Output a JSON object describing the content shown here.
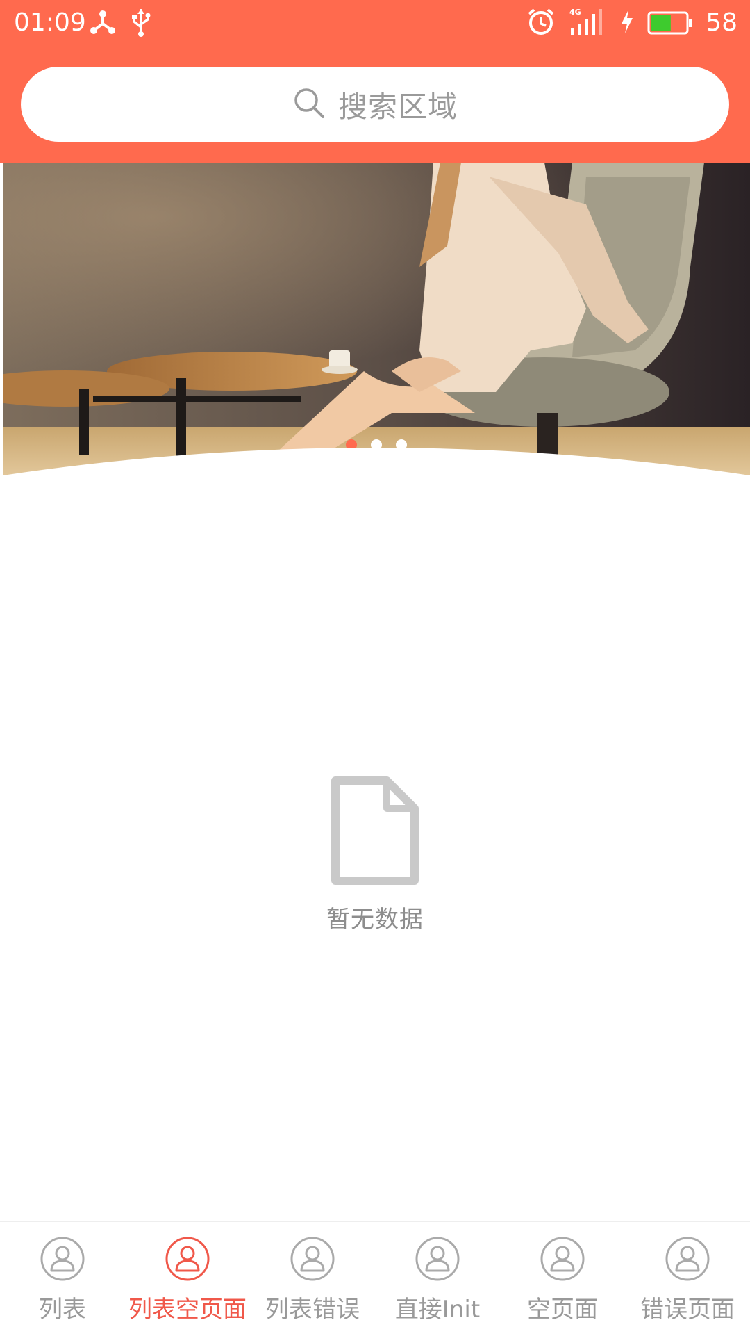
{
  "status_bar": {
    "time": "01:09",
    "left_icons": [
      "share-nodes-icon",
      "usb-icon"
    ],
    "right_icons": [
      "alarm-icon",
      "4g-signal-icon",
      "charging-icon",
      "battery-icon"
    ],
    "network_label": "4G",
    "battery": "58",
    "battery_level": 0.58
  },
  "search": {
    "placeholder": "搜索区域"
  },
  "banner": {
    "indicator_count": 3,
    "active_index": 0
  },
  "empty_state": {
    "icon": "document-icon",
    "text": "暂无数据"
  },
  "tabs": [
    {
      "label": "列表",
      "active": false
    },
    {
      "label": "列表空页面",
      "active": true
    },
    {
      "label": "列表错误",
      "active": false
    },
    {
      "label": "直接Init",
      "active": false
    },
    {
      "label": "空页面",
      "active": false
    },
    {
      "label": "错误页面",
      "active": false
    }
  ],
  "colors": {
    "brand": "#FF6A4E",
    "tab_active": "#F0584A",
    "tab_inactive": "#999999",
    "battery_fill": "#3ECB2E"
  }
}
